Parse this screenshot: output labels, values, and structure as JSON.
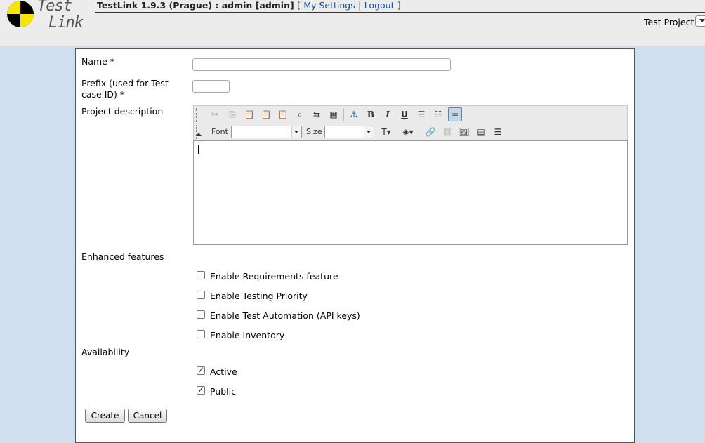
{
  "header": {
    "logo_line1": "Test",
    "logo_line2": "Link",
    "app_info": "TestLink 1.9.3 (Prague) : admin [admin]",
    "bracket_open": "[",
    "my_settings": "My Settings",
    "separator": "|",
    "logout": "Logout",
    "bracket_close": "]",
    "test_project_label": "Test Project"
  },
  "form": {
    "name_label": "Name *",
    "name_value": "",
    "prefix_label": "Prefix (used for Test case ID) *",
    "prefix_value": "",
    "description_label": "Project description",
    "editor": {
      "font_label": "Font",
      "size_label": "Size",
      "font_value": "",
      "size_value": "",
      "buttons": [
        "cut-icon",
        "copy-icon",
        "paste-icon",
        "paste-text-icon",
        "paste-word-icon",
        "find-icon",
        "replace-icon",
        "select-all-icon",
        "anchor-icon",
        "bold-icon",
        "italic-icon",
        "underline-icon",
        "ordered-list-icon",
        "unordered-list-icon",
        "align-left-icon",
        "text-color-icon",
        "background-color-icon",
        "link-icon",
        "unlink-icon",
        "image-icon",
        "table-icon",
        "horizontal-rule-icon"
      ],
      "glyphs": {
        "bold": "B",
        "italic": "I",
        "underline": "U"
      }
    },
    "enhanced_label": "Enhanced features",
    "features": [
      {
        "label": "Enable Requirements feature",
        "checked": false
      },
      {
        "label": "Enable Testing Priority",
        "checked": false
      },
      {
        "label": "Enable Test Automation (API keys)",
        "checked": false
      },
      {
        "label": "Enable Inventory",
        "checked": false
      }
    ],
    "availability_label": "Availability",
    "availability": [
      {
        "label": "Active",
        "checked": true
      },
      {
        "label": "Public",
        "checked": true
      }
    ],
    "create_label": "Create",
    "cancel_label": "Cancel"
  }
}
